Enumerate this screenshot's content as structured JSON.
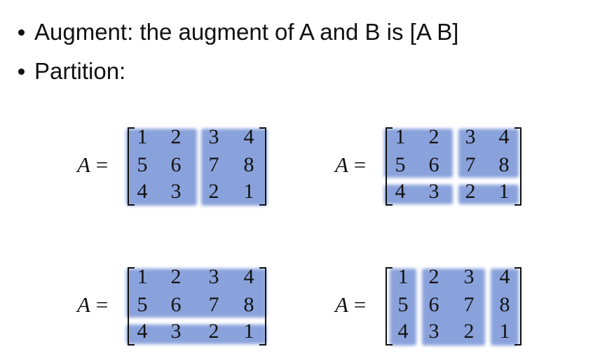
{
  "bullets": [
    {
      "text": "Augment: the augment of A and B is [A B]"
    },
    {
      "text": "Partition:"
    }
  ],
  "matrix": {
    "var": "A",
    "eq": "=",
    "rows": [
      [
        "1",
        "2",
        "3",
        "4"
      ],
      [
        "5",
        "6",
        "7",
        "8"
      ],
      [
        "4",
        "3",
        "2",
        "1"
      ]
    ]
  },
  "shade_color": "#7e98d8"
}
